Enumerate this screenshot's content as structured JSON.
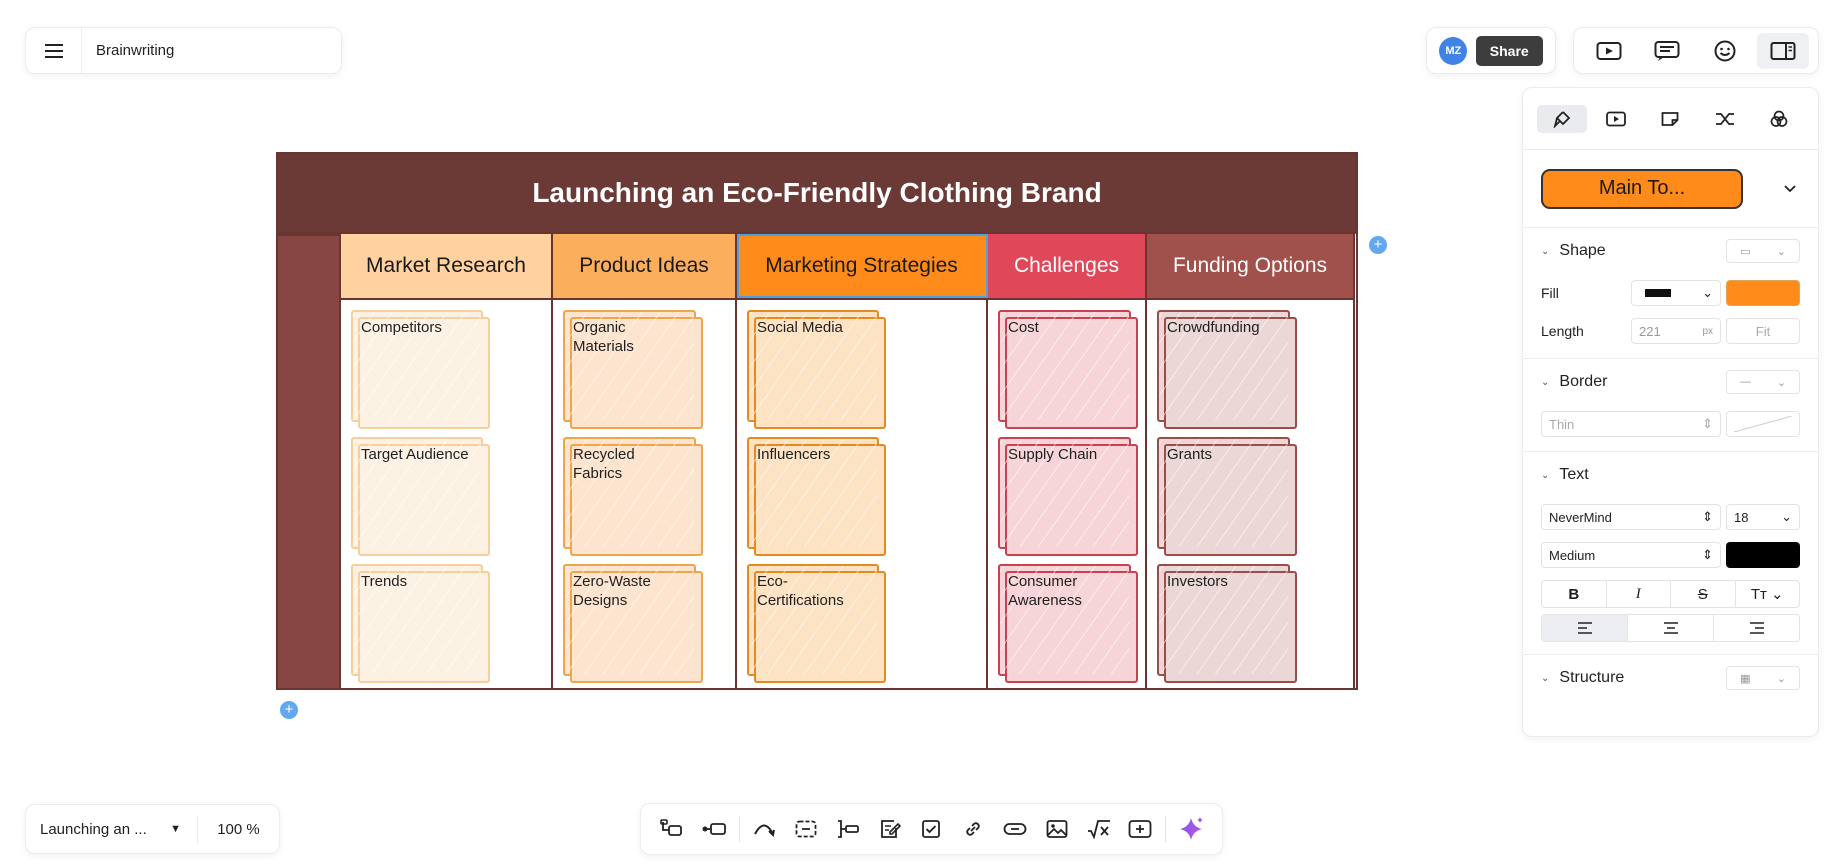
{
  "document": {
    "title": "Brainwriting"
  },
  "share": {
    "avatar_initials": "MZ",
    "button_label": "Share"
  },
  "board": {
    "title": "Launching an Eco-Friendly Clothing Brand",
    "columns": [
      {
        "name": "Market Research",
        "header_bg": "#ffd29f",
        "header_color": "#1a1a1a",
        "note_fill": "#fdf1e4",
        "note_border": "#f5cf9e",
        "notes": [
          "Competitors",
          "Target Audience",
          "Trends"
        ]
      },
      {
        "name": "Product Ideas",
        "header_bg": "#fbaf5d",
        "header_color": "#1a1a1a",
        "note_fill": "#fde4cf",
        "note_border": "#f0a54a",
        "notes": [
          "Organic Materials",
          "Recycled Fabrics",
          "Zero-Waste Designs"
        ]
      },
      {
        "name": "Marketing Strategies",
        "header_bg": "#ff8c1a",
        "header_color": "#1a1a1a",
        "note_fill": "#fde2c3",
        "note_border": "#e68a1e",
        "notes": [
          "Social Media",
          "Influencers",
          "Eco-Certifications"
        ]
      },
      {
        "name": "Challenges",
        "header_bg": "#e0485a",
        "header_color": "#ffffff",
        "note_fill": "#f6d4d8",
        "note_border": "#c9424f",
        "notes": [
          "Cost",
          "Supply Chain",
          "Consumer Awareness"
        ]
      },
      {
        "name": "Funding Options",
        "header_bg": "#a0514c",
        "header_color": "#ffffff",
        "note_fill": "#ead7d6",
        "note_border": "#9b4d49",
        "notes": [
          "Crowdfunding",
          "Grants",
          "Investors"
        ]
      }
    ]
  },
  "properties": {
    "style_preview": "Main To...",
    "shape": {
      "label": "Shape",
      "fill_label": "Fill",
      "fill_color": "#ff8c1a",
      "length_label": "Length",
      "length_value": "221",
      "length_unit": "px",
      "fit_label": "Fit"
    },
    "border": {
      "label": "Border",
      "weight": "Thin"
    },
    "text": {
      "label": "Text",
      "font": "NeverMind",
      "size": "18",
      "weight": "Medium",
      "color": "#000000"
    },
    "structure": {
      "label": "Structure"
    }
  },
  "bottom": {
    "page_name": "Launching an ...",
    "zoom": "100 %"
  }
}
